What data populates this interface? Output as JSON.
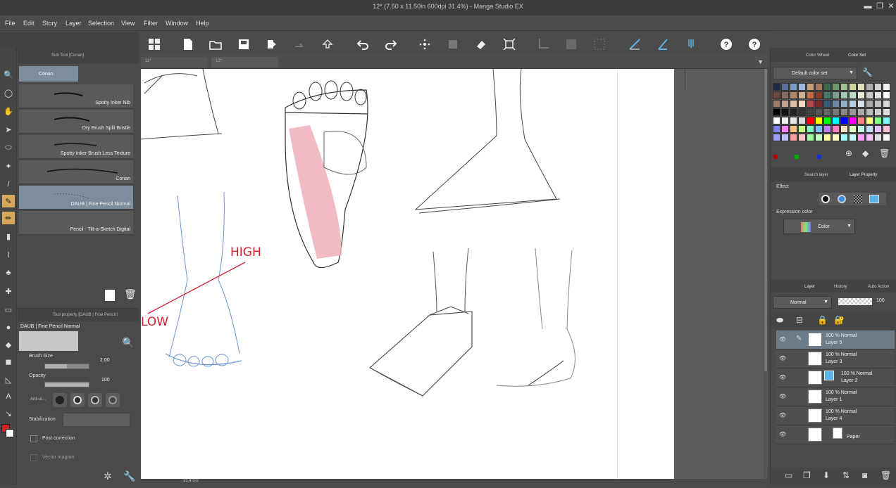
{
  "window": {
    "title": "12* (7.50 x 11.50in 600dpi 31.4%) - Manga Studio EX",
    "minimize": "▬",
    "restore": "❐",
    "close": "✕"
  },
  "menu": [
    "File",
    "Edit",
    "Story",
    "Layer",
    "Selection",
    "View",
    "Filter",
    "Window",
    "Help"
  ],
  "doc_tabs": [
    "11*",
    "12*"
  ],
  "subtool": {
    "header": "Sub Tool [Conan]",
    "group_label": "Conan",
    "items": [
      "Spotty Inker Nib",
      "Dry Brush Split Bristle",
      "Spotty Inker Brush Less Texture",
      "Conan",
      "DAUB | Fine Pencil Normal",
      "Pencil - Tilt-a-Sketch Digital"
    ]
  },
  "toolprop": {
    "header": "Tool property [DAUB | Fine Pencil I",
    "tool_name": "DAUB | Fine Pencil Normal",
    "brush_size_label": "Brush Size",
    "brush_size_value": "2.00",
    "brush_size_level": 0.5,
    "opacity_label": "Opacity",
    "opacity_value": "100",
    "opacity_level": 1.0,
    "antialias_label": "Anti-al...",
    "stabilization_label": "Stabilization",
    "post_correction_label": "Post correction",
    "vector_magnet_label": "Vector magnet"
  },
  "canvas": {
    "annotation_high": "HIGH",
    "annotation_low": "LOW",
    "status_zoom": "31.4  0.0"
  },
  "colorset": {
    "tab_color_wheel": "Color Wheel",
    "tab_color_set": "Color Set",
    "set_name": "Default color set",
    "main_color": "#d21f1f",
    "sub_color": "#ffffff"
  },
  "layerprop": {
    "tab_search": "Search layer",
    "tab_property": "Layer Property",
    "effect_label": "Effect",
    "expression_label": "Expression color",
    "expression_value": "Color"
  },
  "layers": {
    "tab_layer": "Layer",
    "tab_history": "History",
    "tab_auto": "Auto Action",
    "blend_mode": "Normal",
    "opacity": "100",
    "rows": [
      {
        "mode": "100 %  Normal",
        "name": "Layer 5"
      },
      {
        "mode": "100 %  Normal",
        "name": "Layer 3"
      },
      {
        "mode": "100 %  Normal",
        "name": "Layer 2"
      },
      {
        "mode": "100 %  Normal",
        "name": "Layer 1"
      },
      {
        "mode": "100 %  Normal",
        "name": "Layer 4"
      },
      {
        "mode": "",
        "name": "Paper"
      }
    ]
  }
}
